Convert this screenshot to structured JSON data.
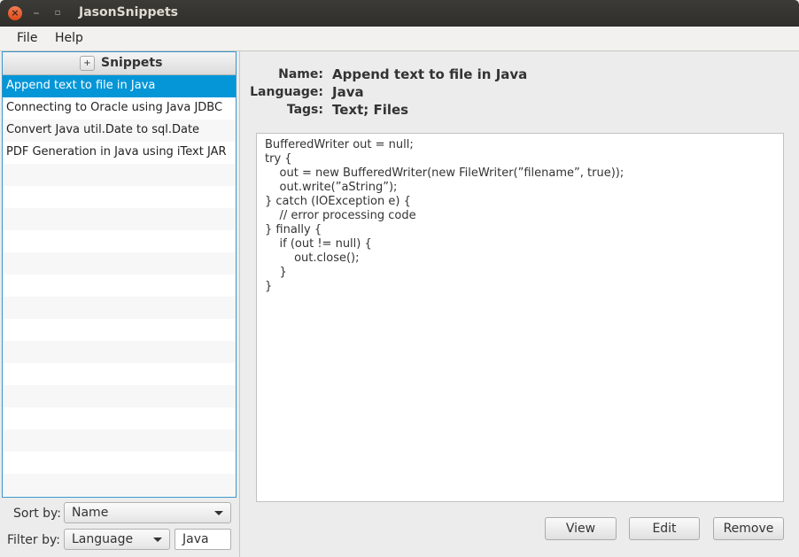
{
  "window": {
    "title": "JasonSnippets"
  },
  "menu": [
    {
      "label": "File"
    },
    {
      "label": "Help"
    }
  ],
  "snippets_panel": {
    "add_label": "+",
    "title": "Snippets",
    "items": [
      {
        "label": "Append text to file in Java",
        "selected": true
      },
      {
        "label": "Connecting to Oracle using Java JDBC",
        "selected": false
      },
      {
        "label": "Convert Java util.Date to sql.Date",
        "selected": false
      },
      {
        "label": "PDF Generation in Java using iText JAR",
        "selected": false
      }
    ]
  },
  "sort": {
    "label": "Sort by:",
    "value": "Name"
  },
  "filter": {
    "label": "Filter by:",
    "value": "Language",
    "text": "Java"
  },
  "details": {
    "name_label": "Name:",
    "name_value": "Append text to file in Java",
    "language_label": "Language:",
    "language_value": "Java",
    "tags_label": "Tags:",
    "tags_value": "Text; Files",
    "code": "BufferedWriter out = null;\ntry {\n\tout = new BufferedWriter(new FileWriter(”filename”, true));\n\tout.write(”aString”);\n} catch (IOException e) {\n\t// error processing code\n} finally {\n\tif (out != null) {\n\t\tout.close();\n\t}\n}"
  },
  "buttons": {
    "view": "View",
    "edit": "Edit",
    "remove": "Remove"
  }
}
